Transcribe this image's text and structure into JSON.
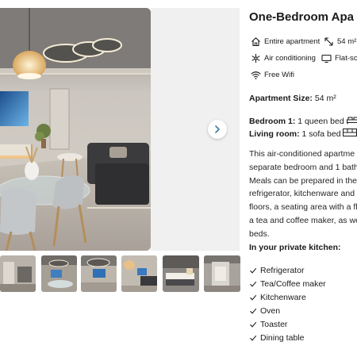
{
  "gallery": {
    "next_label": "next photo",
    "thumbnail_count": 6
  },
  "property": {
    "title": "One-Bedroom Apa",
    "facilities": [
      {
        "icon": "house-icon",
        "label": "Entire apartment"
      },
      {
        "icon": "area-icon",
        "label": "54 m²"
      },
      {
        "icon": "snowflake-icon",
        "label": "Air conditioning"
      },
      {
        "icon": "tv-icon",
        "label": "Flat-scr"
      },
      {
        "icon": "wifi-icon",
        "label": "Free Wifi"
      }
    ],
    "size_label": "Apartment Size:",
    "size_value": "54 m²",
    "rooms": [
      {
        "name": "Bedroom 1:",
        "bed": "1 queen bed",
        "icon": "double-bed-icon"
      },
      {
        "name": "Living room:",
        "bed": "1 sofa bed",
        "icon": "sofa-bed-icon"
      }
    ],
    "description_lines": [
      "This air-conditioned apartme",
      "separate bedroom and 1 bath",
      "Meals can be prepared in the",
      "refrigerator, kitchenware and",
      "floors, a seating area with a fl",
      "a tea and coffee maker, as we",
      "beds."
    ],
    "kitchen_title": "In your private kitchen:",
    "kitchen_items": [
      "Refrigerator",
      "Tea/Coffee maker",
      "Kitchenware",
      "Oven",
      "Toaster",
      "Dining table"
    ]
  },
  "colors": {
    "accent_arrow": "#3b7ea1",
    "text": "#1a1a1a"
  }
}
